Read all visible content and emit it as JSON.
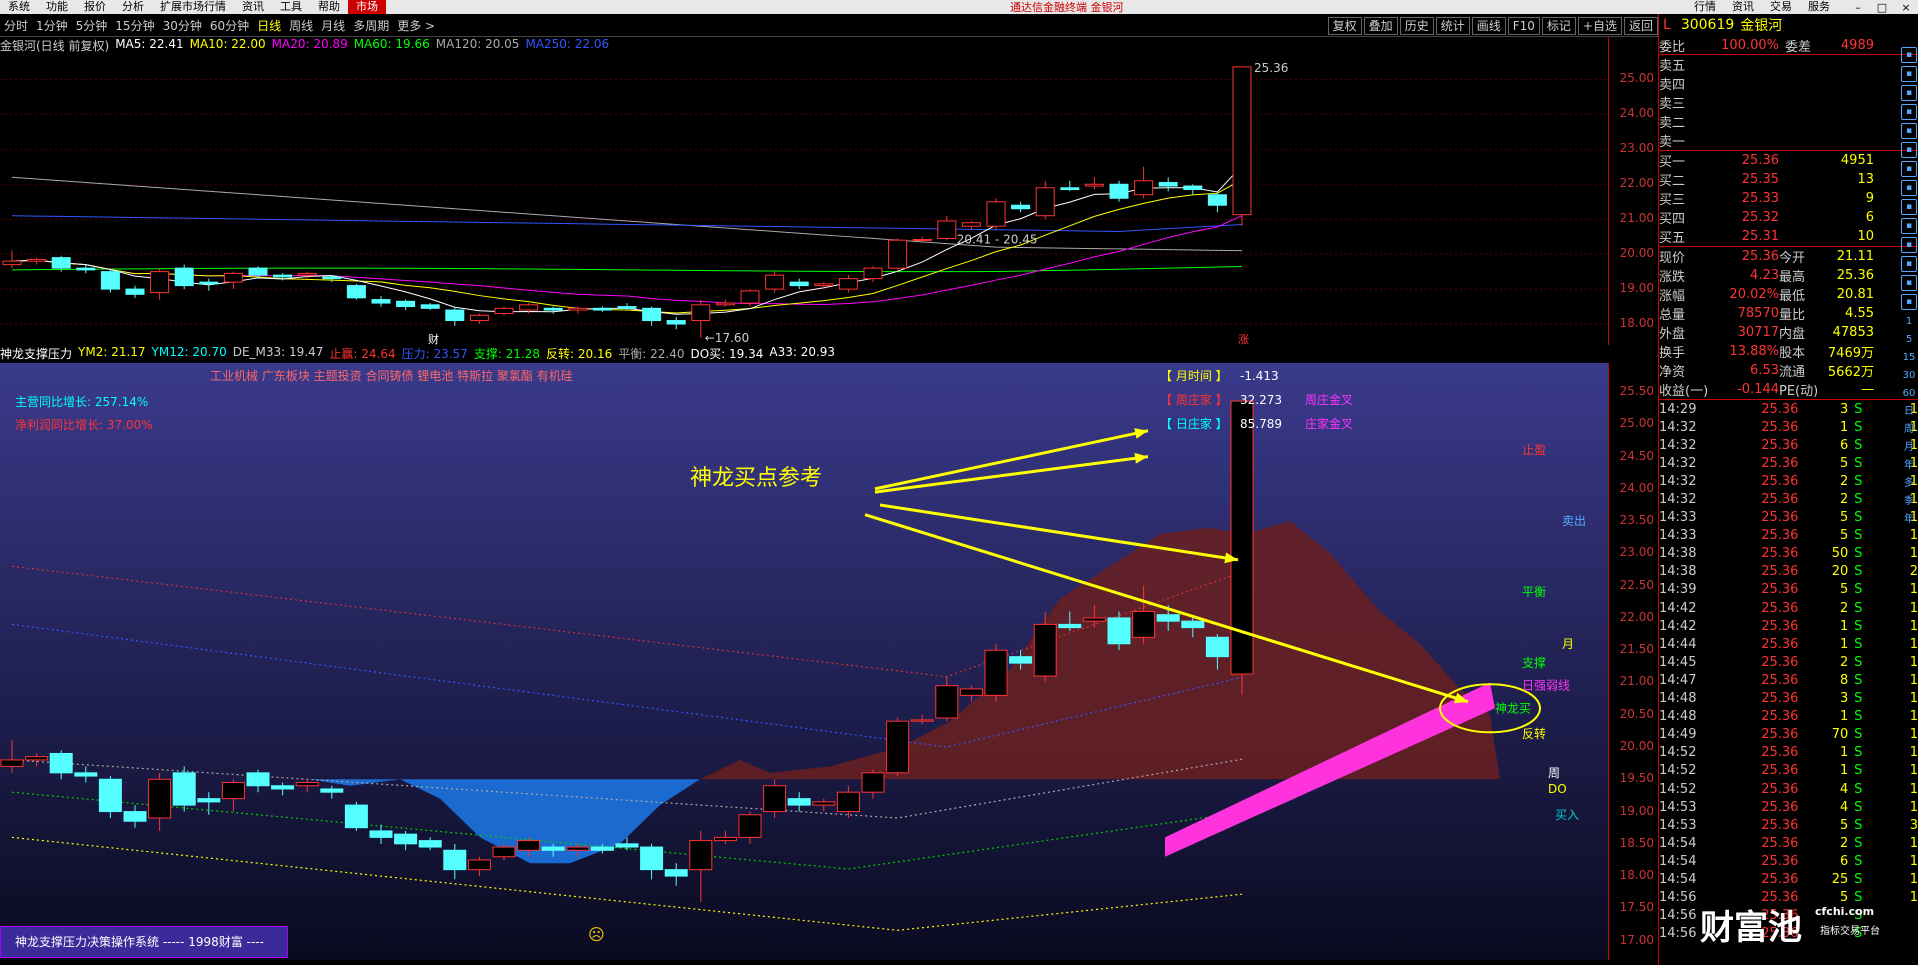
{
  "menubar": {
    "items": [
      "系统",
      "功能",
      "报价",
      "分析",
      "扩展市场行情",
      "资讯",
      "工具",
      "帮助",
      "市场"
    ],
    "active_index": 8,
    "window_title": "通达信金融终端 金银河",
    "right_items": [
      "行情",
      "资讯",
      "交易",
      "服务"
    ]
  },
  "periods": [
    "分时",
    "1分钟",
    "5分钟",
    "15分钟",
    "30分钟",
    "60分钟",
    "日线",
    "周线",
    "月线",
    "多周期",
    "更多 >"
  ],
  "active_period": "日线",
  "toolbar": [
    "复权",
    "叠加",
    "历史",
    "统计",
    "画线",
    "F10",
    "标记",
    "+自选",
    "返回"
  ],
  "ma_legend": [
    {
      "text": "金银河(日线 前复权)",
      "color": "#cccccc"
    },
    {
      "text": "MA5: 22.41",
      "color": "#ffffff"
    },
    {
      "text": "MA10: 22.00",
      "color": "#ffff00"
    },
    {
      "text": "MA20: 20.89",
      "color": "#ff00ff"
    },
    {
      "text": "MA60: 19.66",
      "color": "#00ff00"
    },
    {
      "text": "MA120: 20.05",
      "color": "#aaaaaa"
    },
    {
      "text": "MA250: 22.06",
      "color": "#3355ff"
    }
  ],
  "top_yaxis": [
    "25.00",
    "24.00",
    "23.00",
    "22.00",
    "21.00",
    "20.00",
    "19.00",
    "18.00"
  ],
  "top_annotations": {
    "high": "25.36",
    "range": "20.41 - 20.45",
    "low": "17.60",
    "cai": "财",
    "zhang": "涨"
  },
  "ind_legend": [
    {
      "text": "神龙支撑压力",
      "color": "#ffffff"
    },
    {
      "text": "YM2: 21.17",
      "color": "#ffff00"
    },
    {
      "text": "YM12: 20.70",
      "color": "#00ffff"
    },
    {
      "text": "DE_M33: 19.47",
      "color": "#cccccc"
    },
    {
      "text": "止赢: 24.64",
      "color": "#ff3333"
    },
    {
      "text": "压力: 23.57",
      "color": "#3355ff"
    },
    {
      "text": "支撑: 21.28",
      "color": "#00ff00"
    },
    {
      "text": "反转: 20.16",
      "color": "#ffff00"
    },
    {
      "text": "平衡: 22.40",
      "color": "#aaaaaa"
    },
    {
      "text": "DO买: 19.34",
      "color": "#ffffff"
    },
    {
      "text": "A33: 20.93",
      "color": "#ffffff"
    }
  ],
  "ind_yaxis": [
    "25.50",
    "25.00",
    "24.50",
    "24.00",
    "23.50",
    "23.00",
    "22.50",
    "22.00",
    "21.50",
    "21.00",
    "20.50",
    "20.00",
    "19.50",
    "19.00",
    "18.50",
    "18.00",
    "17.50",
    "17.00"
  ],
  "ind_panel": {
    "concepts": "工业机械 广东板块 主题投资 合同铸债 锂电池 特斯拉 聚氯酯 有机硅",
    "growth1": "主营同比增长: 257.14%",
    "growth2": "净利润同比增长: 37.00%",
    "kv": [
      {
        "label": "【 月时间 】",
        "value": "-1.413",
        "extra": ""
      },
      {
        "label": "【 周庄家 】",
        "value": "32.273",
        "extra": "周庄金叉"
      },
      {
        "label": "【 日庄家 】",
        "value": "85.789",
        "extra": "庄家金叉"
      }
    ],
    "annotation": "神龙买点参考",
    "line_labels": [
      "止盈",
      "卖出",
      "平衡",
      "月",
      "支撑",
      "日强弱线",
      "神龙买",
      "反转",
      "周",
      "DO",
      "买入"
    ]
  },
  "quote": {
    "code": "300619",
    "name": "金银河",
    "wei_bi": "100.00%",
    "wei_cha": "4989",
    "sell": [
      [
        "卖五",
        "",
        ""
      ],
      [
        "卖四",
        "",
        ""
      ],
      [
        "卖三",
        "",
        ""
      ],
      [
        "卖二",
        "",
        ""
      ],
      [
        "卖一",
        "",
        ""
      ]
    ],
    "buy": [
      [
        "买一",
        "25.36",
        "4951"
      ],
      [
        "买二",
        "25.35",
        "13"
      ],
      [
        "买三",
        "25.33",
        "9"
      ],
      [
        "买四",
        "25.32",
        "6"
      ],
      [
        "买五",
        "25.31",
        "10"
      ]
    ],
    "stats": [
      [
        "现价",
        "25.36",
        "今开",
        "21.11"
      ],
      [
        "涨跌",
        "4.23",
        "最高",
        "25.36"
      ],
      [
        "涨幅",
        "20.02%",
        "最低",
        "20.81"
      ],
      [
        "总量",
        "78570",
        "量比",
        "4.55"
      ],
      [
        "外盘",
        "30717",
        "内盘",
        "47853"
      ],
      [
        "换手",
        "13.88%",
        "股本",
        "7469万"
      ],
      [
        "净资",
        "6.53",
        "流通",
        "5662万"
      ],
      [
        "收益(一)",
        "-0.144",
        "PE(动)",
        "—"
      ]
    ]
  },
  "ticks": [
    [
      "14:29",
      "25.36",
      "3",
      "S",
      "1"
    ],
    [
      "14:32",
      "25.36",
      "1",
      "S",
      "1"
    ],
    [
      "14:32",
      "25.36",
      "6",
      "S",
      "1"
    ],
    [
      "14:32",
      "25.36",
      "5",
      "S",
      "1"
    ],
    [
      "14:32",
      "25.36",
      "2",
      "S",
      "1"
    ],
    [
      "14:32",
      "25.36",
      "2",
      "S",
      "1"
    ],
    [
      "14:33",
      "25.36",
      "5",
      "S",
      "1"
    ],
    [
      "14:33",
      "25.36",
      "5",
      "S",
      "1"
    ],
    [
      "14:38",
      "25.36",
      "50",
      "S",
      "1"
    ],
    [
      "14:38",
      "25.36",
      "20",
      "S",
      "2"
    ],
    [
      "14:39",
      "25.36",
      "5",
      "S",
      "1"
    ],
    [
      "14:42",
      "25.36",
      "2",
      "S",
      "1"
    ],
    [
      "14:42",
      "25.36",
      "1",
      "S",
      "1"
    ],
    [
      "14:44",
      "25.36",
      "1",
      "S",
      "1"
    ],
    [
      "14:45",
      "25.36",
      "2",
      "S",
      "1"
    ],
    [
      "14:47",
      "25.36",
      "8",
      "S",
      "1"
    ],
    [
      "14:48",
      "25.36",
      "3",
      "S",
      "1"
    ],
    [
      "14:48",
      "25.36",
      "1",
      "S",
      "1"
    ],
    [
      "14:49",
      "25.36",
      "70",
      "S",
      "1"
    ],
    [
      "14:52",
      "25.36",
      "1",
      "S",
      "1"
    ],
    [
      "14:52",
      "25.36",
      "1",
      "S",
      "1"
    ],
    [
      "14:52",
      "25.36",
      "4",
      "S",
      "1"
    ],
    [
      "14:53",
      "25.36",
      "4",
      "S",
      "1"
    ],
    [
      "14:53",
      "25.36",
      "5",
      "S",
      "3"
    ],
    [
      "14:54",
      "25.36",
      "2",
      "S",
      "1"
    ],
    [
      "14:54",
      "25.36",
      "6",
      "S",
      "1"
    ],
    [
      "14:54",
      "25.36",
      "25",
      "S",
      "1"
    ],
    [
      "14:56",
      "25.36",
      "5",
      "S",
      "1"
    ],
    [
      "14:56",
      "25.36",
      "",
      "S",
      ""
    ],
    [
      "14:56",
      "25.36",
      "",
      "S",
      ""
    ]
  ],
  "side_icons": [
    "up-icon",
    "down-icon",
    "chart-icon",
    "list-icon",
    "bar-icon",
    "doc-icon",
    "grid-icon",
    "fund-icon",
    "f10-icon",
    "edit-icon",
    "calc-icon",
    "news-icon",
    "money-icon",
    "clock-icon"
  ],
  "side_labels": [
    "1",
    "5",
    "15",
    "30",
    "60",
    "日",
    "周",
    "月",
    "年",
    "多",
    "季",
    "年"
  ],
  "banner": "神龙支撑压力决策操作系统  -----  1998财富  ----",
  "watermark": {
    "main": "财富池",
    "sub": "cfchi.com",
    "sub2": "指标交易平台"
  },
  "candles": [
    [
      19.7,
      20.1,
      19.6,
      19.8
    ],
    [
      19.8,
      19.9,
      19.7,
      19.85
    ],
    [
      19.9,
      19.95,
      19.5,
      19.6
    ],
    [
      19.6,
      19.7,
      19.45,
      19.55
    ],
    [
      19.5,
      19.55,
      18.9,
      19.0
    ],
    [
      19.0,
      19.1,
      18.75,
      18.85
    ],
    [
      18.9,
      19.6,
      18.7,
      19.5
    ],
    [
      19.6,
      19.7,
      19.0,
      19.1
    ],
    [
      19.2,
      19.3,
      18.95,
      19.15
    ],
    [
      19.2,
      19.5,
      19.0,
      19.45
    ],
    [
      19.6,
      19.65,
      19.3,
      19.4
    ],
    [
      19.4,
      19.45,
      19.25,
      19.35
    ],
    [
      19.4,
      19.5,
      19.3,
      19.45
    ],
    [
      19.35,
      19.4,
      19.2,
      19.3
    ],
    [
      19.1,
      19.15,
      18.7,
      18.75
    ],
    [
      18.7,
      18.8,
      18.5,
      18.6
    ],
    [
      18.65,
      18.7,
      18.4,
      18.5
    ],
    [
      18.55,
      18.6,
      18.4,
      18.45
    ],
    [
      18.4,
      18.5,
      17.95,
      18.1
    ],
    [
      18.1,
      18.3,
      18.0,
      18.25
    ],
    [
      18.3,
      18.5,
      18.25,
      18.45
    ],
    [
      18.4,
      18.6,
      18.3,
      18.55
    ],
    [
      18.45,
      18.5,
      18.3,
      18.4
    ],
    [
      18.4,
      18.5,
      18.3,
      18.45
    ],
    [
      18.45,
      18.5,
      18.35,
      18.4
    ],
    [
      18.5,
      18.6,
      18.4,
      18.45
    ],
    [
      18.45,
      18.5,
      17.95,
      18.1
    ],
    [
      18.1,
      18.2,
      17.85,
      18.0
    ],
    [
      18.1,
      18.7,
      17.6,
      18.55
    ],
    [
      18.55,
      18.7,
      18.5,
      18.6
    ],
    [
      18.6,
      19.0,
      18.5,
      18.95
    ],
    [
      19.0,
      19.5,
      18.9,
      19.4
    ],
    [
      19.2,
      19.3,
      19.0,
      19.1
    ],
    [
      19.1,
      19.2,
      19.0,
      19.15
    ],
    [
      19.0,
      19.4,
      18.9,
      19.3
    ],
    [
      19.3,
      19.65,
      19.2,
      19.6
    ],
    [
      19.6,
      20.45,
      19.55,
      20.4
    ],
    [
      20.4,
      20.5,
      20.35,
      20.42
    ],
    [
      20.45,
      21.1,
      20.4,
      20.95
    ],
    [
      20.8,
      20.95,
      20.7,
      20.9
    ],
    [
      20.8,
      21.6,
      20.7,
      21.5
    ],
    [
      21.4,
      21.5,
      21.2,
      21.3
    ],
    [
      21.1,
      22.1,
      21.0,
      21.9
    ],
    [
      21.9,
      22.1,
      21.8,
      21.85
    ],
    [
      21.95,
      22.2,
      21.85,
      22.0
    ],
    [
      22.0,
      22.1,
      21.5,
      21.6
    ],
    [
      21.7,
      22.5,
      21.6,
      22.1
    ],
    [
      22.05,
      22.2,
      21.8,
      21.95
    ],
    [
      21.95,
      22.0,
      21.7,
      21.85
    ],
    [
      21.7,
      21.75,
      21.2,
      21.4
    ],
    [
      21.13,
      25.36,
      20.81,
      25.36
    ]
  ]
}
